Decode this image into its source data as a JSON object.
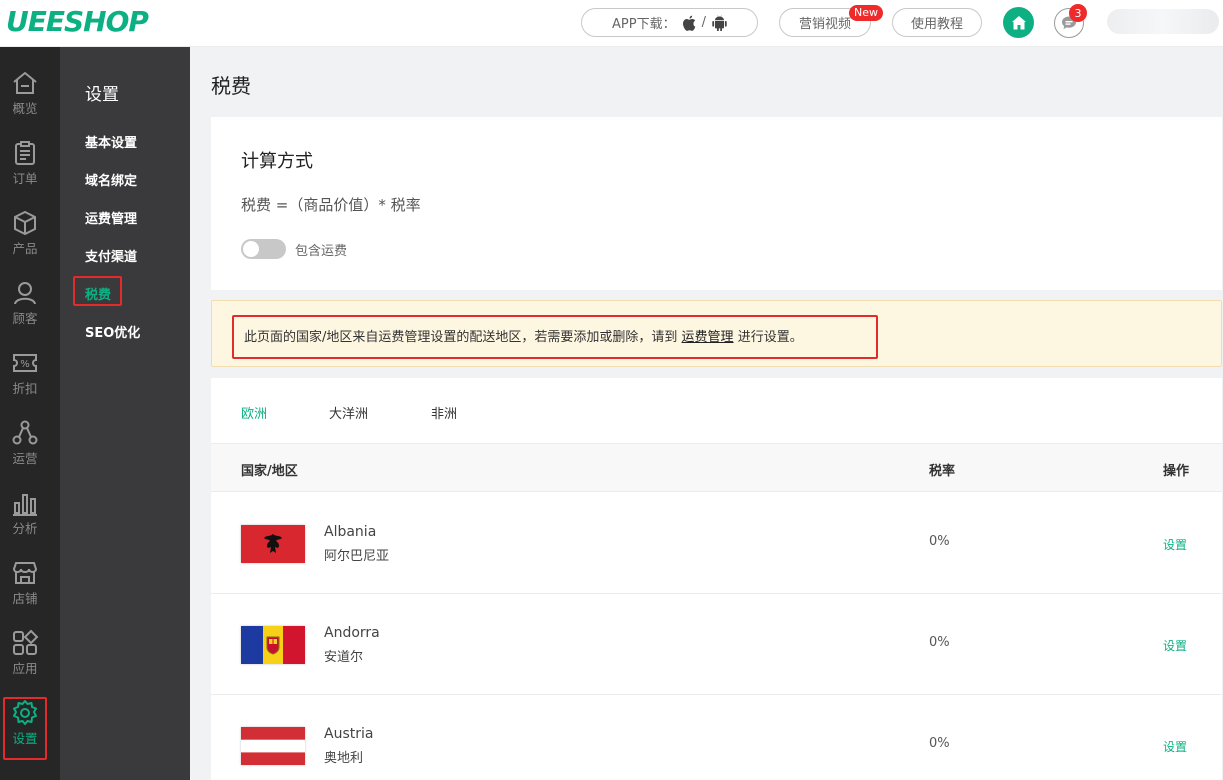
{
  "header": {
    "logo": "UEESHOP",
    "app_download": "APP下载：",
    "app_separator": "/",
    "video_label": "营销视频",
    "new_badge": "New",
    "tutorial_label": "使用教程",
    "message_count": "3"
  },
  "iconbar": {
    "items": [
      {
        "label": "概览",
        "icon": "home-outline-icon"
      },
      {
        "label": "订单",
        "icon": "clipboard-icon"
      },
      {
        "label": "产品",
        "icon": "box-icon"
      },
      {
        "label": "顾客",
        "icon": "user-icon"
      },
      {
        "label": "折扣",
        "icon": "discount-ticket-icon"
      },
      {
        "label": "运营",
        "icon": "network-icon"
      },
      {
        "label": "分析",
        "icon": "bar-chart-icon"
      },
      {
        "label": "店铺",
        "icon": "store-icon"
      },
      {
        "label": "应用",
        "icon": "apps-icon"
      },
      {
        "label": "设置",
        "icon": "gear-icon",
        "active": true
      }
    ]
  },
  "submenu": {
    "title": "设置",
    "items": [
      "基本设置",
      "域名绑定",
      "运费管理",
      "支付渠道",
      "税费",
      "SEO优化"
    ],
    "active_index": 4
  },
  "page": {
    "title": "税费"
  },
  "calc": {
    "title": "计算方式",
    "formula": "税费 =（商品价值）* 税率",
    "toggle_label": "包含运费",
    "toggle_on": false
  },
  "notice": {
    "text_before": "此页面的国家/地区来自运费管理设置的配送地区，若需要添加或删除，请到",
    "link": "运费管理",
    "text_after": "进行设置。"
  },
  "tabs": [
    "欧洲",
    "大洋洲",
    "非洲"
  ],
  "table": {
    "headers": {
      "country": "国家/地区",
      "rate": "税率",
      "action": "操作"
    },
    "rows": [
      {
        "name_en": "Albania",
        "name_zh": "阿尔巴尼亚",
        "rate": "0%",
        "action": "设置",
        "flag": "albania-flag-icon"
      },
      {
        "name_en": "Andorra",
        "name_zh": "安道尔",
        "rate": "0%",
        "action": "设置",
        "flag": "andorra-flag-icon"
      },
      {
        "name_en": "Austria",
        "name_zh": "奥地利",
        "rate": "0%",
        "action": "设置",
        "flag": "austria-flag-icon"
      }
    ]
  },
  "colors": {
    "brand": "#0cb083",
    "highlight_border": "#e32b2b",
    "sidebar_dark": "#262626",
    "submenu_bg": "#3a3a3c",
    "notice_bg": "#fdf6e0"
  }
}
